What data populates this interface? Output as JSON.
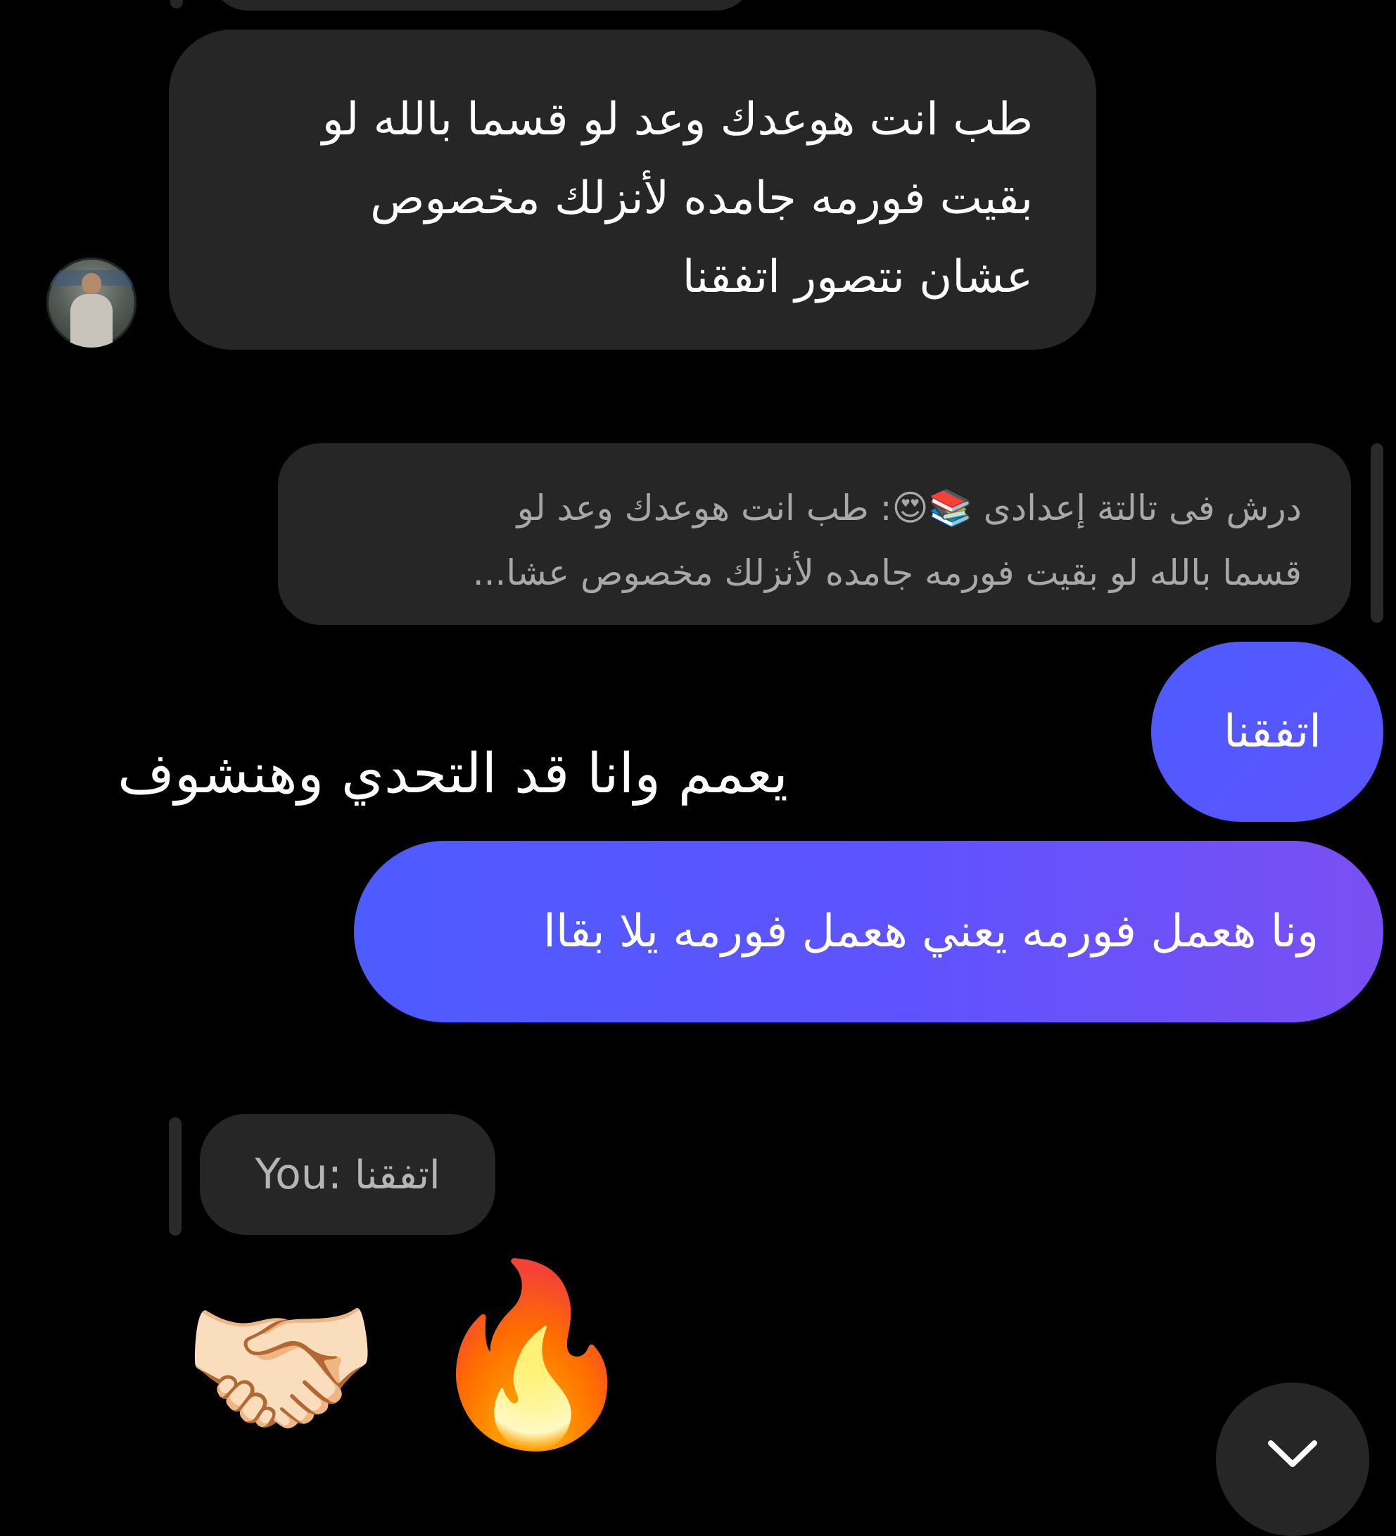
{
  "conversation": {
    "incoming_message": {
      "line1": "طب انت هوعدك وعد لو قسما بالله لو",
      "line2": "بقيت فورمه جامده لأنزلك مخصوص",
      "line3": "عشان نتصور اتفقنا"
    },
    "reply_quote_to_incoming": {
      "line1_before_emoji": "درش فى تالتة إعدادى",
      "emoji": "📚😍",
      "line1_after_emoji": ": طب انت هوعدك وعد لو",
      "line2": "قسما بالله لو بقيت فورمه جامده لأنزلك مخصوص عشا..."
    },
    "outgoing_short": "اتفقنا",
    "overlay_caption": "يعمم وانا قد التحدي وهنشوف",
    "outgoing_long": "ونا هعمل فورمه يعني هعمل فورمه يلا بقاا",
    "reply_quote_to_outgoing": {
      "sender": "You:",
      "text": "اتفقنا"
    },
    "reactions": {
      "handshake": "🤝🏻",
      "fire": "🔥"
    }
  },
  "colors": {
    "background": "#000000",
    "incoming_bubble": "#262626",
    "outgoing_gradient_start": "#4d5bff",
    "outgoing_gradient_end": "#7a4ff2",
    "quote_text": "#a8a8a8"
  },
  "icons": {
    "scroll_down": "chevron-down-icon",
    "avatar": "contact-avatar"
  }
}
